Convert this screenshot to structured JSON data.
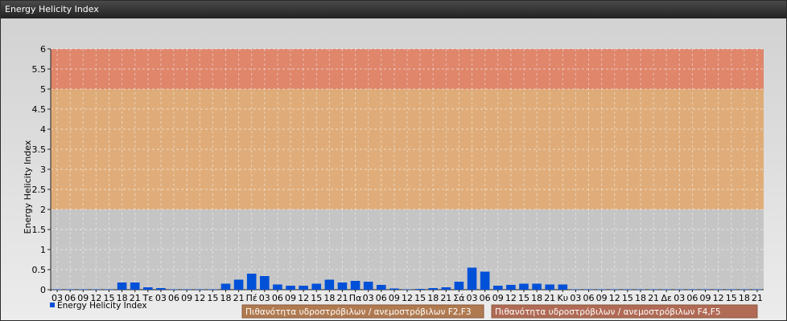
{
  "window": {
    "title": "Energy Helicity Index"
  },
  "chart_data": {
    "type": "bar",
    "ylabel": "Energy Helicity Index",
    "ylim": [
      0,
      6
    ],
    "yticks": [
      "0",
      "0.5",
      "1",
      "1.5",
      "2",
      "2.5",
      "3",
      "3.5",
      "4",
      "4.5",
      "5",
      "5.5",
      "6"
    ],
    "categories": [
      "03",
      "06",
      "09",
      "12",
      "15",
      "18",
      "21",
      "Τε",
      "03",
      "06",
      "09",
      "12",
      "15",
      "18",
      "21",
      "Πέ",
      "03",
      "06",
      "09",
      "12",
      "15",
      "18",
      "21",
      "Πα",
      "03",
      "06",
      "09",
      "12",
      "15",
      "18",
      "21",
      "Σά",
      "03",
      "06",
      "09",
      "12",
      "15",
      "18",
      "21",
      "Κυ",
      "03",
      "06",
      "09",
      "12",
      "15",
      "18",
      "21",
      "Δε",
      "03",
      "06",
      "09",
      "12",
      "15",
      "18",
      "21"
    ],
    "series": [
      {
        "name": "Energy Helicity Index",
        "color": "#0050d8",
        "values": [
          0.01,
          0.01,
          0.01,
          0.01,
          0.01,
          0.18,
          0.18,
          0.06,
          0.04,
          0.01,
          0.01,
          0.01,
          0.01,
          0.15,
          0.25,
          0.4,
          0.34,
          0.13,
          0.1,
          0.1,
          0.15,
          0.25,
          0.18,
          0.22,
          0.2,
          0.12,
          0.03,
          0.01,
          0.02,
          0.04,
          0.06,
          0.2,
          0.55,
          0.45,
          0.1,
          0.12,
          0.15,
          0.15,
          0.13,
          0.13,
          0.01,
          0.01,
          0.01,
          0.01,
          0.01,
          0.01,
          0.01,
          0.01,
          0.01,
          0.01,
          0.01,
          0.01,
          0.01,
          0.01,
          0.01
        ]
      }
    ],
    "bands": [
      {
        "from": 0,
        "to": 2,
        "color": "#b8b8b8",
        "opacity": 0.7
      },
      {
        "from": 2,
        "to": 5,
        "color": "#e0a060",
        "opacity": 0.8
      },
      {
        "from": 5,
        "to": 6,
        "color": "#e07858",
        "opacity": 0.85
      }
    ],
    "grid": true,
    "legend_position": "bottom-left",
    "band_legend": [
      {
        "label": "Πιθανότητα υδροστρόβιλων / ανεμοστρόβιλων F2,F3",
        "color": "#b07a50"
      },
      {
        "label": "Πιθανότητα υδροστρόβιλων / ανεμοστρόβιλων F4,F5",
        "color": "#b06a55"
      }
    ]
  }
}
